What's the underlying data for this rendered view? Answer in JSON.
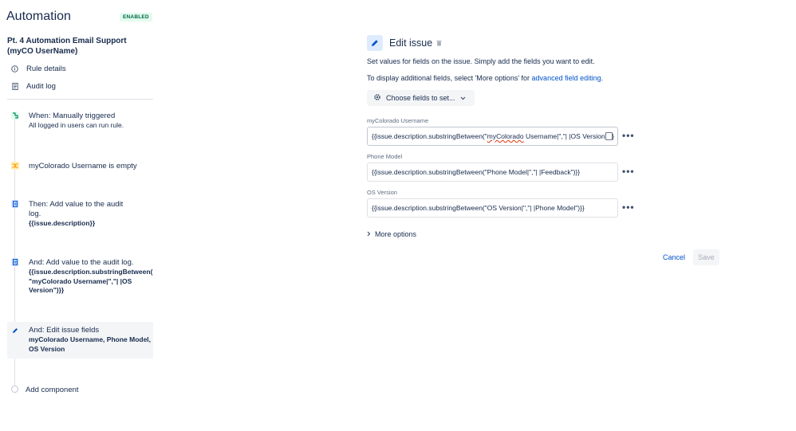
{
  "app": {
    "title": "Automation",
    "status_badge": "ENABLED",
    "rule_name": "Pt. 4 Automation Email Support (myCO UserName)"
  },
  "sidebar": {
    "nav": [
      {
        "label": "Rule details",
        "icon": "info-icon"
      },
      {
        "label": "Audit log",
        "icon": "document-icon"
      }
    ],
    "components": [
      {
        "title": "When: Manually triggered",
        "subtitle": "All logged in users can run rule.",
        "icon": "trigger-icon",
        "color": "#36b37e"
      },
      {
        "title": "myColorado Username is empty",
        "subtitle": "",
        "icon": "condition-icon",
        "color": "#ffab00"
      },
      {
        "title": "Then: Add value to the audit log.",
        "subtitle": "{{issue.description}}",
        "icon": "audit-log-icon",
        "color": "#0065ff"
      },
      {
        "title": "And: Add value to the audit log.",
        "subtitle": "{{issue.description.substringBetween( \"myColorado Username|\",\"| |OS Version\")}}",
        "icon": "audit-log-icon",
        "color": "#0065ff"
      },
      {
        "title": "And: Edit issue fields",
        "subtitle": "myColorado Username, Phone Model, OS Version",
        "icon": "pencil-icon",
        "color": "#0065ff"
      }
    ],
    "add_component": "Add component"
  },
  "panel": {
    "title": "Edit issue",
    "desc1": "Set values for fields on the issue. Simply add the fields you want to edit.",
    "desc2_prefix": "To display additional fields, select 'More options' for ",
    "desc2_link": "advanced field editing",
    "desc2_suffix": ".",
    "choose_button": "Choose fields to set...",
    "fields": [
      {
        "label": "myColorado Username",
        "value_pre": "{{issue.description.substringBetween(\"",
        "value_err": "myColorado",
        "value_post": " Username|\",\"| |OS Version\")}}"
      },
      {
        "label": "Phone Model",
        "value": "{{issue.description.substringBetween(\"Phone Model|\",\"| |Feedback\")}}"
      },
      {
        "label": "OS Version",
        "value": "{{issue.description.substringBetween(\"OS Version|\",\"| |Phone Model\")}}"
      }
    ],
    "more_options": "More options",
    "cancel": "Cancel",
    "save": "Save"
  },
  "colors": {
    "accent": "#0052cc",
    "badge_bg": "#e3fcef",
    "badge_text": "#006644"
  }
}
